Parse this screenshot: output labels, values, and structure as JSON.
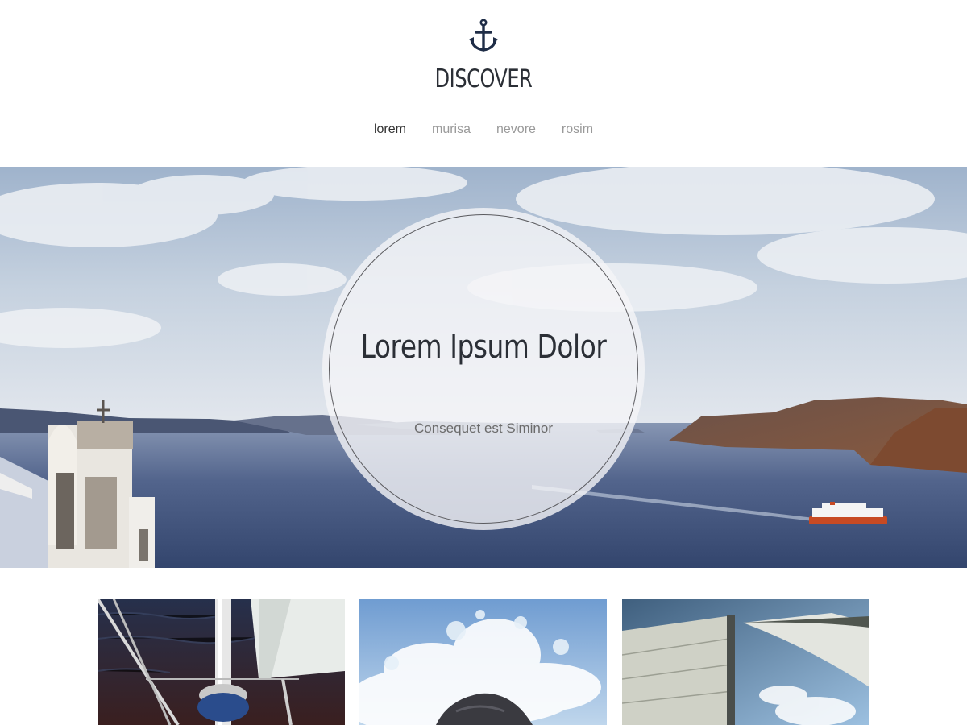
{
  "header": {
    "logo_icon": "anchor-icon",
    "site_title": "DISCOVER",
    "brand_color": "#1f2d47"
  },
  "nav": {
    "items": [
      {
        "label": "lorem",
        "active": true
      },
      {
        "label": "murisa",
        "active": false
      },
      {
        "label": "nevore",
        "active": false
      },
      {
        "label": "rosim",
        "active": false
      }
    ]
  },
  "hero": {
    "heading": "Lorem Ipsum Dolor",
    "subheading": "Consequet est Siminor",
    "image": "sea-coast-with-ferry"
  },
  "gallery": {
    "thumbnails": [
      {
        "image": "boat-mast-over-dark-water"
      },
      {
        "image": "wave-splash-on-rock"
      },
      {
        "image": "sails-against-sky"
      }
    ]
  },
  "colors": {
    "text_dark": "#2b2f36",
    "nav_inactive": "#9a9a9a",
    "nav_active": "#333333",
    "subheading": "#6b6b6b"
  }
}
